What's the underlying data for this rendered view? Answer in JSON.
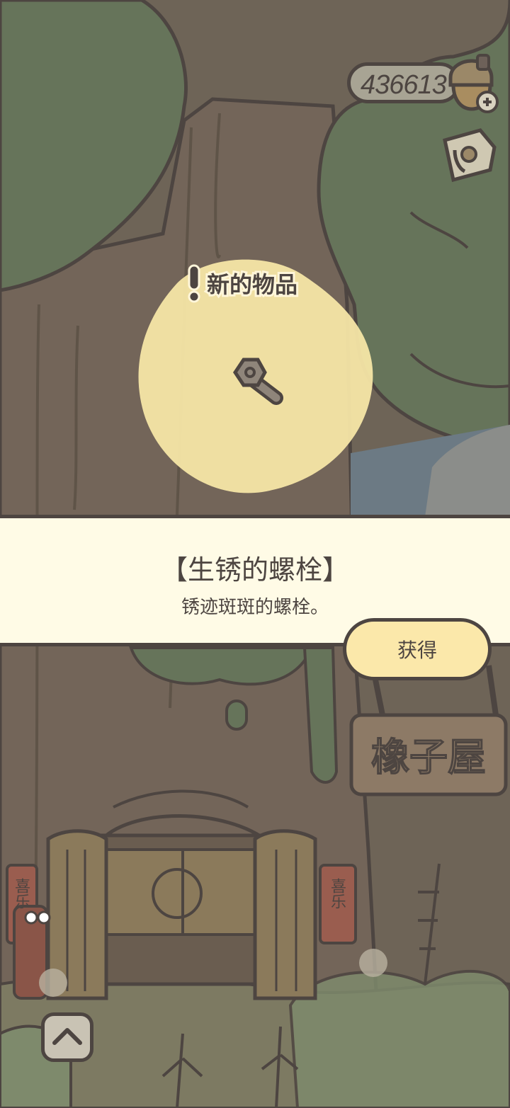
{
  "header": {
    "acorn_count": "436613",
    "add_icon": "plus-icon",
    "ticket_icon": "ticket-icon"
  },
  "popup": {
    "badge_label": "新的物品",
    "item_name": "【生锈的螺栓】",
    "item_description": "锈迹斑斑的螺栓。",
    "obtain_button": "获得",
    "item_icon": "rusty-bolt-icon"
  },
  "scene": {
    "shop_sign": "橡子屋",
    "couplet_left": "喜乐",
    "couplet_right": "喜乐"
  },
  "footer": {
    "up_icon": "chevron-up-icon"
  },
  "colors": {
    "outline": "#4d4541",
    "panel": "#fffbe6",
    "button": "#fbe8aa",
    "glow": "#f6e6a6",
    "tree": "#66745a",
    "trunk": "#736559"
  }
}
